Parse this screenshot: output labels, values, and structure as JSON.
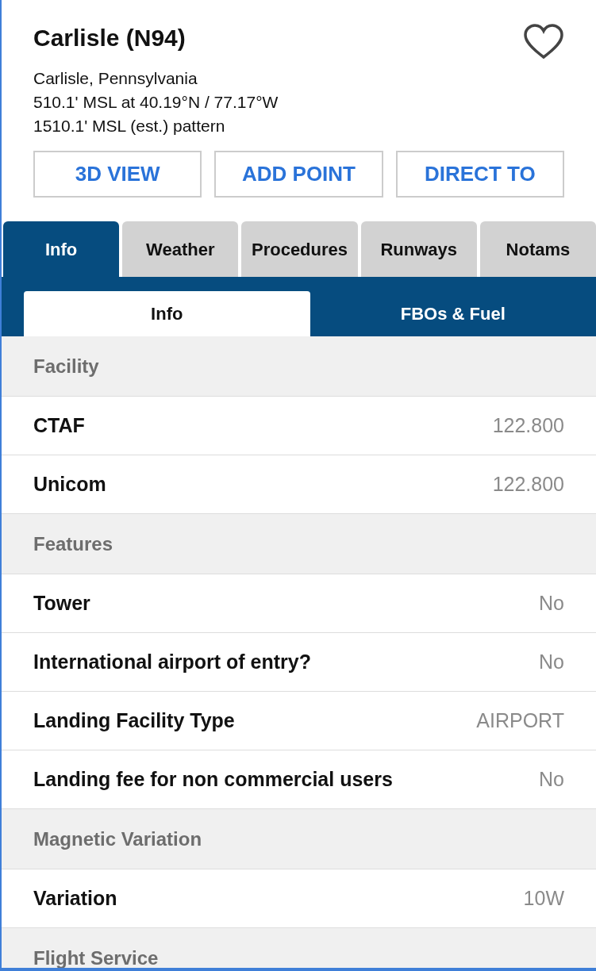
{
  "airport": {
    "title": "Carlisle (N94)",
    "favorite": false,
    "lines": [
      "Carlisle, Pennsylvania",
      "510.1' MSL at 40.19°N / 77.17°W",
      "1510.1' MSL (est.) pattern"
    ]
  },
  "actions": [
    "3D VIEW",
    "ADD POINT",
    "DIRECT TO"
  ],
  "tabs": [
    {
      "label": "Info",
      "selected": true
    },
    {
      "label": "Weather",
      "selected": false
    },
    {
      "label": "Procedures",
      "selected": false
    },
    {
      "label": "Runways",
      "selected": false
    },
    {
      "label": "Notams",
      "selected": false
    }
  ],
  "subtabs": [
    {
      "label": "Info",
      "selected": true
    },
    {
      "label": "FBOs & Fuel",
      "selected": false
    }
  ],
  "list": [
    {
      "kind": "section",
      "label": "Facility"
    },
    {
      "kind": "row",
      "label": "CTAF",
      "value": "122.800"
    },
    {
      "kind": "row",
      "label": "Unicom",
      "value": "122.800"
    },
    {
      "kind": "section",
      "label": "Features"
    },
    {
      "kind": "row",
      "label": "Tower",
      "value": "No"
    },
    {
      "kind": "row",
      "label": "International airport of entry?",
      "value": "No"
    },
    {
      "kind": "row",
      "label": "Landing Facility Type",
      "value": "AIRPORT"
    },
    {
      "kind": "row",
      "label": "Landing fee for non commercial users",
      "value": "No"
    },
    {
      "kind": "section",
      "label": "Magnetic Variation"
    },
    {
      "kind": "row",
      "label": "Variation",
      "value": "10W"
    },
    {
      "kind": "section",
      "label": "Flight Service"
    }
  ]
}
